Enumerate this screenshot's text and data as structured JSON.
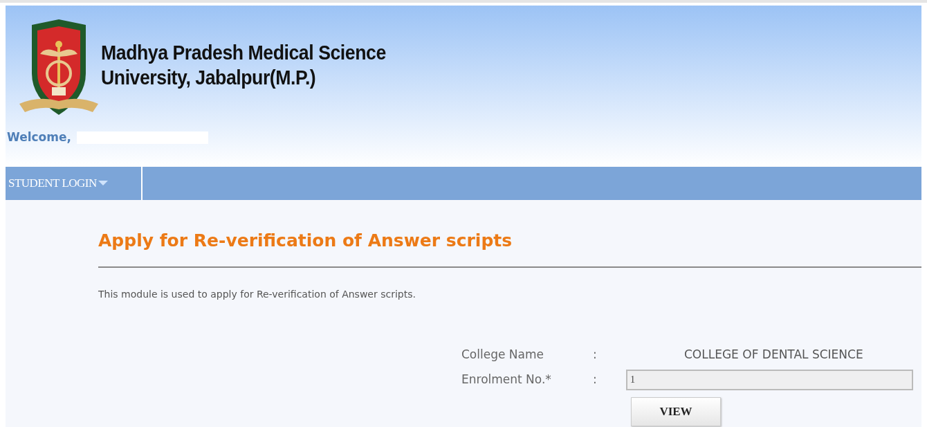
{
  "header": {
    "university_name": [
      "Madhya Pradesh Medical Science",
      "University, Jabalpur(M.P.)"
    ],
    "welcome": "Welcome,"
  },
  "nav": [
    {
      "label": "STUDENT LOGIN"
    }
  ],
  "page": {
    "title": "Apply for Re-verification of Answer scripts",
    "description": "This module is used to apply for Re-verification of Answer scripts."
  },
  "form": {
    "fields": [
      {
        "kind": "text",
        "label": "College Name",
        "colon": ":",
        "value": "COLLEGE OF DENTAL SCIENCE"
      },
      {
        "kind": "input",
        "label": "Enrolment No.*",
        "colon": ":",
        "value": "1"
      }
    ],
    "button": "VIEW"
  }
}
